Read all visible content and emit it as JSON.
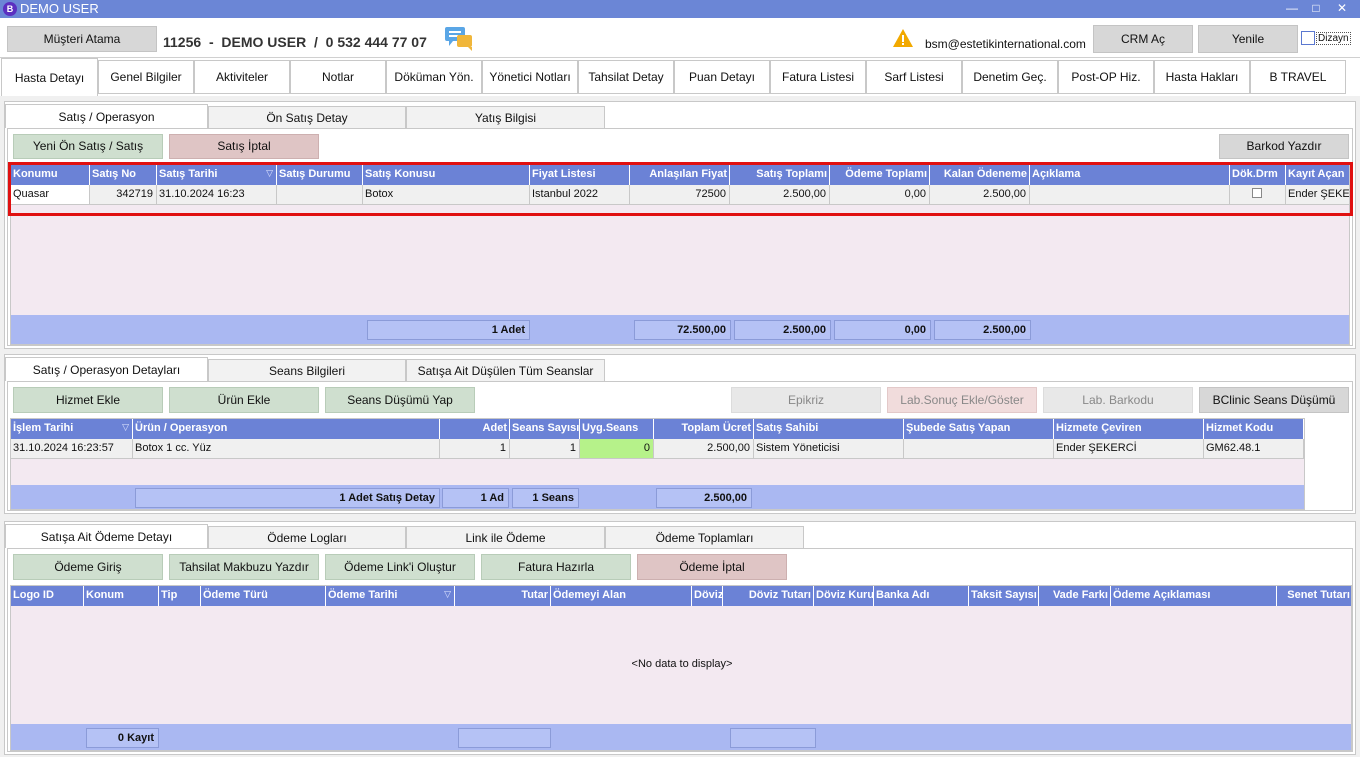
{
  "window": {
    "title": "DEMO USER",
    "logo_letter": "B",
    "min": "—",
    "max": "□",
    "close": "✕"
  },
  "header": {
    "musteri_atama": "Müşteri Atama",
    "patient_id": "11256",
    "sep1": "-",
    "patient_name": "DEMO USER",
    "sep2": "/",
    "phone": "0 532 444 77 07",
    "email": "bsm@estetikinternational.com",
    "crm": "CRM Aç",
    "refresh": "Yenile",
    "dizayn": "Dizayn"
  },
  "tabs": [
    "Hasta Detayı",
    "Genel Bilgiler",
    "Aktiviteler",
    "Notlar",
    "Döküman Yön.",
    "Yönetici Notları",
    "Tahsilat Detay",
    "Puan Detayı",
    "Fatura Listesi",
    "Sarf Listesi",
    "Denetim Geç.",
    "Post-OP Hiz.",
    "Hasta Hakları",
    "B TRAVEL"
  ],
  "p1": {
    "tabs": [
      "Satış / Operasyon",
      "Ön Satış Detay",
      "Yatış Bilgisi"
    ],
    "btn_new": "Yeni Ön Satış / Satış",
    "btn_cancel": "Satış İptal",
    "btn_barcode": "Barkod Yazdır",
    "columns": [
      "Konumu",
      "Satış No",
      "Satış Tarihi",
      "Satış Durumu",
      "Satış Konusu",
      "Fiyat Listesi",
      "Anlaşılan Fiyat",
      "Satış Toplamı",
      "Ödeme Toplamı",
      "Kalan Ödeneme",
      "Açıklama",
      "Dök.Drm",
      "Kayıt Açan"
    ],
    "row": {
      "konum": "Quasar",
      "no": "342719",
      "tarih": "31.10.2024 16:23",
      "durum": "",
      "konu": "Botox",
      "fiyat_listesi": "Istanbul 2022",
      "anlasilan": "72500",
      "satis_toplam": "2.500,00",
      "odeme_toplam": "0,00",
      "kalan": "2.500,00",
      "aciklama": "",
      "kayit": "Ender ŞEKERCİ"
    },
    "footer": {
      "count": "1 Adet",
      "f1": "72.500,00",
      "f2": "2.500,00",
      "f3": "0,00",
      "f4": "2.500,00"
    }
  },
  "p2": {
    "tabs": [
      "Satış / Operasyon Detayları",
      "Seans Bilgileri",
      "Satışa Ait Düşülen Tüm Seanslar"
    ],
    "buttons": [
      "Hizmet Ekle",
      "Ürün Ekle",
      "Seans Düşümü Yap",
      "Epikriz",
      "Lab.Sonuç Ekle/Göster",
      "Lab. Barkodu",
      "BClinic Seans Düşümü"
    ],
    "columns": [
      "İşlem Tarihi",
      "Ürün / Operasyon",
      "Adet",
      "Seans Sayısı",
      "Uyg.Seans",
      "Toplam Ücret",
      "Satış Sahibi",
      "Şubede Satış Yapan",
      "Hizmete Çeviren",
      "Hizmet Kodu"
    ],
    "row": {
      "tarih": "31.10.2024 16:23:57",
      "urun": "Botox 1 cc. Yüz",
      "adet": "1",
      "seans": "1",
      "uyg": "0",
      "ucret": "2.500,00",
      "sahip": "Sistem Yöneticisi",
      "sube": "",
      "ceviren": "Ender ŞEKERCİ",
      "kod": "GM62.48.1"
    },
    "footer": {
      "f1": "1 Adet Satış Detay",
      "f2": "1 Ad",
      "f3": "1 Seans",
      "f4": "2.500,00"
    }
  },
  "p3": {
    "tabs": [
      "Satışa Ait Ödeme Detayı",
      "Ödeme Logları",
      "Link ile Ödeme",
      "Ödeme Toplamları"
    ],
    "buttons": [
      "Ödeme Giriş",
      "Tahsilat Makbuzu Yazdır",
      "Ödeme Link'i Oluştur",
      "Fatura Hazırla",
      "Ödeme İptal"
    ],
    "columns": [
      "Logo ID",
      "Konum",
      "Tip",
      "Ödeme Türü",
      "Ödeme Tarihi",
      "Tutar",
      "Ödemeyi Alan",
      "Döviz",
      "Döviz Tutarı",
      "Döviz Kuru",
      "Banka Adı",
      "Taksit Sayısı",
      "Vade Farkı",
      "Ödeme Açıklaması",
      "Senet Tutarı"
    ],
    "empty": "<No data to display>",
    "footer": {
      "count": "0 Kayıt"
    }
  },
  "colors": {
    "grid_header": "#6b82d6",
    "footer": "#aab8f2",
    "highlight": "#e01010",
    "green_cell": "#b6f28a"
  },
  "icons": {
    "chat": "chat-icon",
    "warning": "warning-icon",
    "sort": "sort-icon"
  }
}
